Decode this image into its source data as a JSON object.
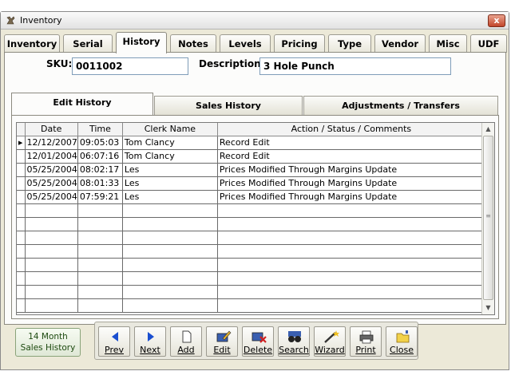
{
  "window": {
    "title": "Inventory",
    "close_glyph": "x"
  },
  "tabs": [
    "Inventory",
    "Serial",
    "History",
    "Notes",
    "Levels",
    "Pricing",
    "Type",
    "Vendor",
    "Misc",
    "UDF"
  ],
  "active_tab": "History",
  "sku": {
    "label": "SKU:",
    "value": "0011002"
  },
  "description": {
    "label": "Description:",
    "value": "3 Hole Punch"
  },
  "subtabs": [
    "Edit History",
    "Sales History",
    "Adjustments / Transfers"
  ],
  "active_subtab": "Edit History",
  "grid": {
    "columns": [
      "Date",
      "Time",
      "Clerk Name",
      "Action / Status / Comments"
    ],
    "rows": [
      {
        "date": "12/12/2007",
        "time": "09:05:03",
        "clerk": "Tom Clancy",
        "action": "Record Edit"
      },
      {
        "date": "12/01/2004",
        "time": "06:07:16",
        "clerk": "Tom Clancy",
        "action": "Record Edit"
      },
      {
        "date": "05/25/2004",
        "time": "08:02:17",
        "clerk": "Les",
        "action": "Prices Modified Through Margins Update"
      },
      {
        "date": "05/25/2004",
        "time": "08:01:33",
        "clerk": "Les",
        "action": "Prices Modified Through Margins Update"
      },
      {
        "date": "05/25/2004",
        "time": "07:59:21",
        "clerk": "Les",
        "action": "Prices Modified Through Margins Update"
      }
    ]
  },
  "month_button": {
    "line1": "14 Month",
    "line2": "Sales History"
  },
  "toolbar": [
    {
      "name": "prev",
      "label": "Prev",
      "icon": "left-arrow-icon"
    },
    {
      "name": "next",
      "label": "Next",
      "icon": "right-arrow-icon"
    },
    {
      "name": "add",
      "label": "Add",
      "icon": "document-icon"
    },
    {
      "name": "edit",
      "label": "Edit",
      "icon": "edit-icon"
    },
    {
      "name": "delete",
      "label": "Delete",
      "icon": "delete-icon"
    },
    {
      "name": "search",
      "label": "Search",
      "icon": "binoculars-icon"
    },
    {
      "name": "wizard",
      "label": "Wizard",
      "icon": "wand-icon"
    },
    {
      "name": "print",
      "label": "Print",
      "icon": "printer-icon"
    },
    {
      "name": "close",
      "label": "Close",
      "icon": "folder-icon"
    }
  ],
  "colors": {
    "accent_blue": "#1a4fd0",
    "title_close_red": "#c2452a"
  }
}
